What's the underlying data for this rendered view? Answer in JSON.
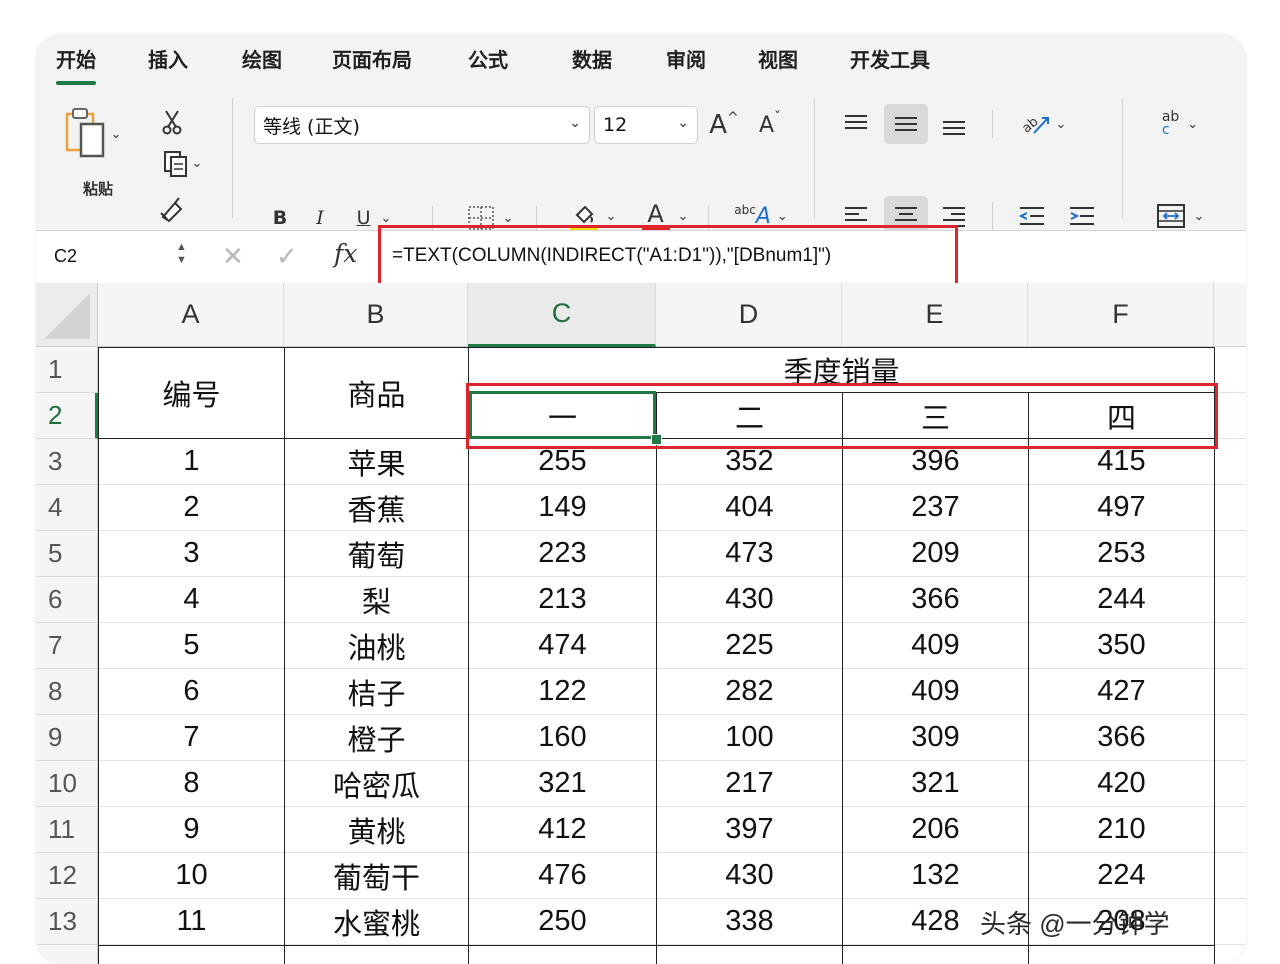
{
  "tabs": [
    "开始",
    "插入",
    "绘图",
    "页面布局",
    "公式",
    "数据",
    "审阅",
    "视图",
    "开发工具"
  ],
  "ribbon": {
    "paste_label": "粘贴",
    "font_name": "等线 (正文)",
    "font_size": "12",
    "bold": "B",
    "italic": "I",
    "underline": "U",
    "font_color_glyph": "A",
    "grow_font": "A",
    "shrink_font": "A",
    "phonetic_small": "abc",
    "phonetic_big": "A",
    "wrap_glyph_top": "ab",
    "wrap_glyph_bottom": "c",
    "accent_fill": "#f2e000",
    "accent_font": "#e02424"
  },
  "formula_bar": {
    "name_box": "C2",
    "fx": "fx",
    "formula": "=TEXT(COLUMN(INDIRECT(\"A1:D1\")),\"[DBnum1]\")"
  },
  "sheet": {
    "columns": [
      "A",
      "B",
      "C",
      "D",
      "E",
      "F"
    ],
    "rows": [
      "1",
      "2",
      "3",
      "4",
      "5",
      "6",
      "7",
      "8",
      "9",
      "10",
      "11",
      "12",
      "13"
    ],
    "header": {
      "id": "编号",
      "product": "商品",
      "quarter_group": "季度销量",
      "quarters": [
        "一",
        "二",
        "三",
        "四"
      ]
    },
    "data": [
      [
        "1",
        "苹果",
        "255",
        "352",
        "396",
        "415"
      ],
      [
        "2",
        "香蕉",
        "149",
        "404",
        "237",
        "497"
      ],
      [
        "3",
        "葡萄",
        "223",
        "473",
        "209",
        "253"
      ],
      [
        "4",
        "梨",
        "213",
        "430",
        "366",
        "244"
      ],
      [
        "5",
        "油桃",
        "474",
        "225",
        "409",
        "350"
      ],
      [
        "6",
        "桔子",
        "122",
        "282",
        "409",
        "427"
      ],
      [
        "7",
        "橙子",
        "160",
        "100",
        "309",
        "366"
      ],
      [
        "8",
        "哈密瓜",
        "321",
        "217",
        "321",
        "420"
      ],
      [
        "9",
        "黄桃",
        "412",
        "397",
        "206",
        "210"
      ],
      [
        "10",
        "葡萄干",
        "476",
        "430",
        "132",
        "224"
      ],
      [
        "11",
        "水蜜桃",
        "250",
        "338",
        "428",
        "208"
      ]
    ],
    "selected_cell": "C2",
    "selection_color": "#1f7a45",
    "highlight_color": "#e0242e"
  },
  "watermark": "头条 @一分钟学"
}
